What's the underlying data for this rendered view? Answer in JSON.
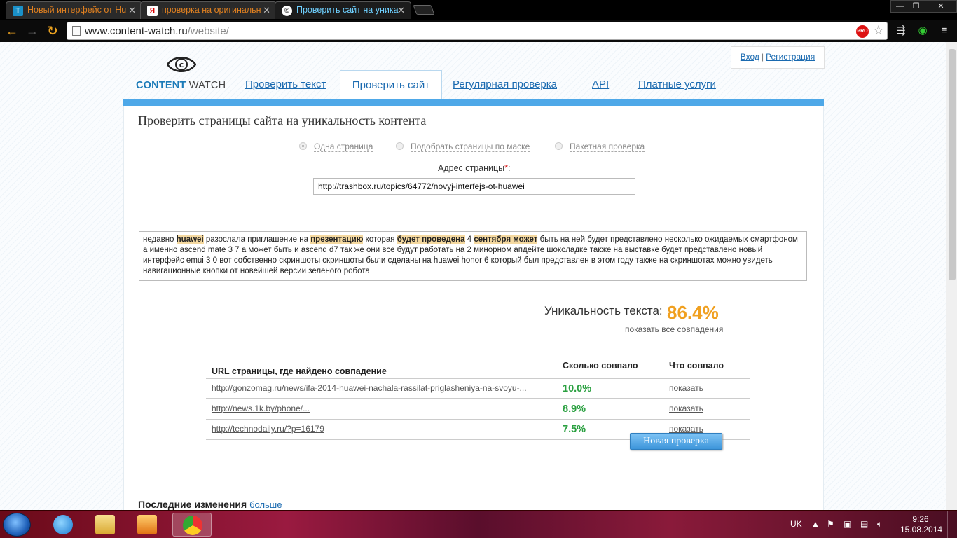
{
  "browser": {
    "tabs": [
      {
        "title": "Новый интерфейс от Hu",
        "favicon": "T"
      },
      {
        "title": "проверка на оригинальн",
        "favicon": "Я"
      },
      {
        "title": "Проверить сайт на уника",
        "favicon": "©"
      }
    ],
    "url_host": "www.content-watch.ru",
    "url_path": "/website/",
    "pro_badge": "PRO"
  },
  "site": {
    "logo_primary": "CONTENT",
    "logo_secondary": "WATCH",
    "login": "Вход",
    "register": "Регистрация",
    "nav": [
      "Проверить текст",
      "Проверить сайт",
      "Регулярная проверка",
      "API",
      "Платные услуги"
    ]
  },
  "form": {
    "title": "Проверить страницы сайта на уникальность контента",
    "modes": [
      "Одна страница",
      "Подобрать страницы по маске",
      "Пакетная проверка"
    ],
    "address_label": "Адрес страницы",
    "required_mark": "*",
    "address_colon": ":",
    "address_value": "http://trashbox.ru/topics/64772/novyj-interfejs-ot-huawei"
  },
  "text_segments": [
    {
      "t": "недавно ",
      "h": false
    },
    {
      "t": "huawei",
      "h": true
    },
    {
      "t": " разослала приглашение на ",
      "h": false
    },
    {
      "t": "презентацию",
      "h": true
    },
    {
      "t": " которая ",
      "h": false
    },
    {
      "t": "будет проведена",
      "h": true
    },
    {
      "t": " 4 ",
      "h": false
    },
    {
      "t": "сентября может",
      "h": true
    },
    {
      "t": " быть на ней будет представлено несколько ожидаемых смартфоном а именно ascend mate 3 7 а может быть и ascend d7 так же они все будут работать на 2 минорном апдейте шоколадке также на выставке будет представлено новый интерфейс emui 3 0 вот собственно скриншоты скриншоты были сделаны на huawei honor 6 который был представлен в этом году также на скриншотах можно увидеть навигационные кнопки от новейшей версии зеленого робота",
      "h": false
    }
  ],
  "result": {
    "uniqueness_label": "Уникальность текста:",
    "uniqueness_value": "86.4%",
    "show_all": "показать все совпадения",
    "headers": {
      "url": "URL страницы, где найдено совпадение",
      "pct": "Сколько совпало",
      "what": "Что совпало"
    },
    "rows": [
      {
        "url": "http://gonzomag.ru/news/ifa-2014-huawei-nachala-rassilat-priglasheniya-na-svoyu-...",
        "pct": "10.0%",
        "show": "показать"
      },
      {
        "url": "http://news.1k.by/phone/...",
        "pct": "8.9%",
        "show": "показать"
      },
      {
        "url": "http://technodaily.ru/?p=16179",
        "pct": "7.5%",
        "show": "показать"
      }
    ],
    "new_check": "Новая проверка"
  },
  "recent": {
    "title": "Последние изменения",
    "more": "больше"
  },
  "taskbar": {
    "lang": "UK",
    "time": "9:26",
    "date": "15.08.2014"
  },
  "colors": {
    "accent_blue": "#4ea8e8",
    "uniqueness_orange": "#f0a020",
    "match_green": "#2aa040",
    "highlight": "#f5d9a0"
  }
}
